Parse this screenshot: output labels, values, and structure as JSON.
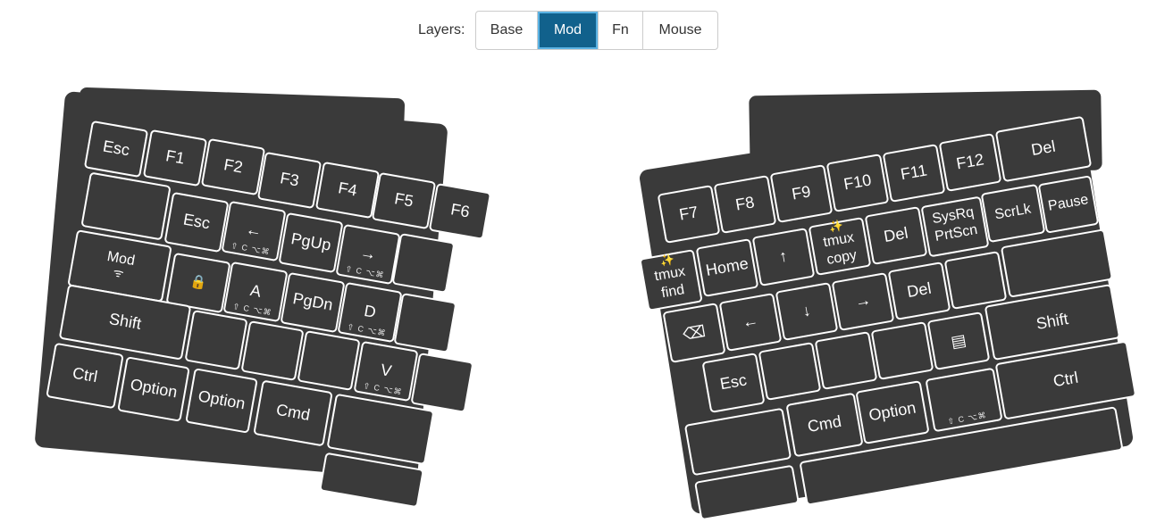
{
  "layer_bar": {
    "label": "Layers:",
    "buttons": [
      {
        "label": "Base",
        "active": false
      },
      {
        "label": "Mod",
        "active": true
      },
      {
        "label": "Fn",
        "active": false
      },
      {
        "label": "Mouse",
        "active": false
      }
    ]
  },
  "mod_suffix": "⇧ C ⌥⌘",
  "left": {
    "keys": [
      {
        "id": "esc",
        "label": "Esc"
      },
      {
        "id": "f1",
        "label": "F1"
      },
      {
        "id": "f2",
        "label": "F2"
      },
      {
        "id": "f3",
        "label": "F3"
      },
      {
        "id": "f4",
        "label": "F4"
      },
      {
        "id": "f5",
        "label": "F5"
      },
      {
        "id": "f6",
        "label": "F6"
      },
      {
        "id": "tab-blank",
        "label": ""
      },
      {
        "id": "esc2",
        "label": "Esc"
      },
      {
        "id": "left-arrow",
        "label": "←",
        "sub": true
      },
      {
        "id": "pgup",
        "label": "PgUp"
      },
      {
        "id": "right-arrow",
        "label": "→",
        "sub": true
      },
      {
        "id": "blank-r1",
        "label": ""
      },
      {
        "id": "mod",
        "label": "Mod",
        "icon": "ᯤ"
      },
      {
        "id": "lock",
        "label": "🔒"
      },
      {
        "id": "a",
        "label": "A",
        "sub": true
      },
      {
        "id": "pgdn",
        "label": "PgDn"
      },
      {
        "id": "d",
        "label": "D",
        "sub": true
      },
      {
        "id": "blank-r2",
        "label": ""
      },
      {
        "id": "shift",
        "label": "Shift"
      },
      {
        "id": "blank-r3a",
        "label": ""
      },
      {
        "id": "blank-r3b",
        "label": ""
      },
      {
        "id": "blank-r3c",
        "label": ""
      },
      {
        "id": "v",
        "label": "V",
        "sub": true
      },
      {
        "id": "blank-r3d",
        "label": ""
      },
      {
        "id": "ctrl",
        "label": "Ctrl"
      },
      {
        "id": "option1",
        "label": "Option"
      },
      {
        "id": "option2",
        "label": "Option"
      },
      {
        "id": "cmd",
        "label": "Cmd"
      },
      {
        "id": "blank-r4",
        "label": ""
      },
      {
        "id": "space",
        "label": ""
      },
      {
        "id": "blank-r5",
        "label": ""
      }
    ]
  },
  "right": {
    "keys": [
      {
        "id": "f7",
        "label": "F7"
      },
      {
        "id": "f8",
        "label": "F8"
      },
      {
        "id": "f9",
        "label": "F9"
      },
      {
        "id": "f10",
        "label": "F10"
      },
      {
        "id": "f11",
        "label": "F11"
      },
      {
        "id": "f12",
        "label": "F12"
      },
      {
        "id": "del-top",
        "label": "Del"
      },
      {
        "id": "tmux-find",
        "label": "tmux\nfind",
        "icon": "✨"
      },
      {
        "id": "home",
        "label": "Home"
      },
      {
        "id": "up-arrow",
        "label": "↑"
      },
      {
        "id": "tmux-copy",
        "label": "tmux\ncopy",
        "icon": "✨"
      },
      {
        "id": "del-mid",
        "label": "Del"
      },
      {
        "id": "sysrq",
        "label": "SysRq\nPrtScn"
      },
      {
        "id": "scrlk",
        "label": "ScrLk"
      },
      {
        "id": "pause",
        "label": "Pause"
      },
      {
        "id": "backspace",
        "label": "⌫"
      },
      {
        "id": "left-arrow-r",
        "label": "←"
      },
      {
        "id": "down-arrow",
        "label": "↓"
      },
      {
        "id": "right-arrow-r",
        "label": "→"
      },
      {
        "id": "del-low",
        "label": "Del"
      },
      {
        "id": "blank-r2a",
        "label": ""
      },
      {
        "id": "blank-r2b",
        "label": ""
      },
      {
        "id": "esc-r",
        "label": "Esc"
      },
      {
        "id": "blank-r3a",
        "label": ""
      },
      {
        "id": "blank-r3b",
        "label": ""
      },
      {
        "id": "blank-r3c",
        "label": ""
      },
      {
        "id": "menu",
        "label": "▤"
      },
      {
        "id": "shift-r",
        "label": "Shift"
      },
      {
        "id": "blank-r4a",
        "label": ""
      },
      {
        "id": "cmd-r",
        "label": "Cmd"
      },
      {
        "id": "option-r",
        "label": "Option"
      },
      {
        "id": "hyper",
        "label": "",
        "sub": true
      },
      {
        "id": "ctrl-r",
        "label": "Ctrl"
      },
      {
        "id": "blank-r5a",
        "label": ""
      },
      {
        "id": "space-r",
        "label": ""
      }
    ]
  }
}
